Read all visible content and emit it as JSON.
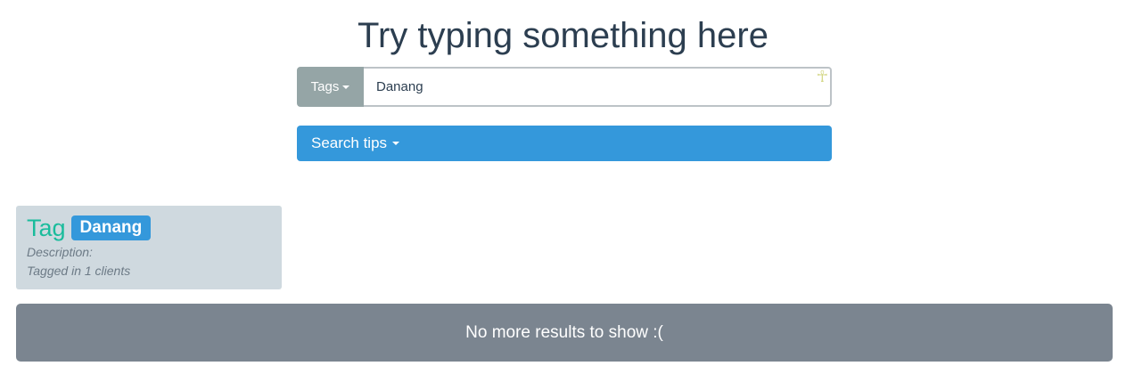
{
  "header": {
    "title": "Try typing something here"
  },
  "search": {
    "type_label": "Tags",
    "value": "Danang",
    "ankh_glyph": "☥"
  },
  "tips": {
    "label": "Search tips"
  },
  "results": [
    {
      "type": "Tag",
      "tag": "Danang",
      "description": "Description:",
      "count_text": "Tagged in 1 clients"
    }
  ],
  "footer": {
    "no_more": "No more results to show :("
  },
  "colors": {
    "accent": "#3498db",
    "type_button": "#95a5a6",
    "card_bg": "#cfd9df",
    "card_type": "#1abc9c",
    "footer_bg": "#7b8590",
    "title": "#2c3e50"
  },
  "icons": {
    "dropdown": "caret-down-icon",
    "input_decoration": "ankh-icon"
  }
}
